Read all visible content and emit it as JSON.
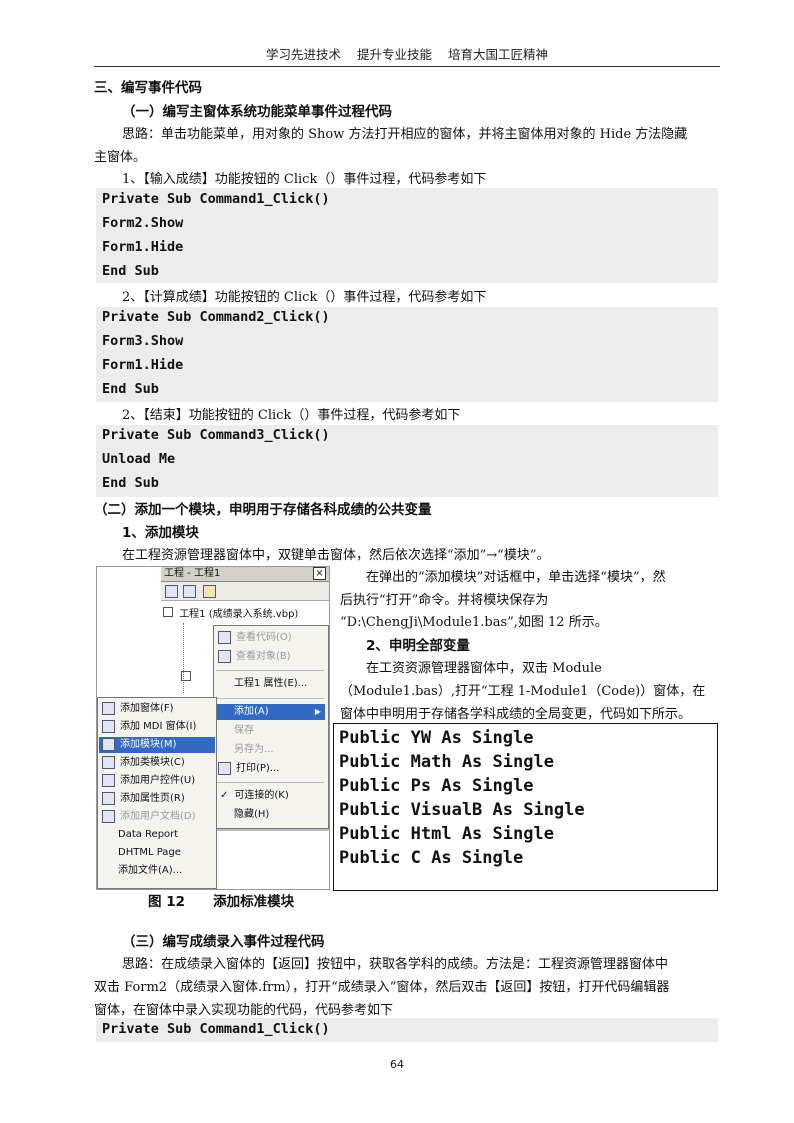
{
  "header": {
    "text": "学习先进技术    提升专业技能    培育大国工匠精神"
  },
  "section3": {
    "title": "三、编写事件代码"
  },
  "sub1": {
    "title": "（一）编写主窗体系统功能菜单事件过程代码"
  },
  "idea1": {
    "line1": "思路：单击功能菜单，用对象的 Show 方法打开相应的窗体，并将主窗体用对象的 Hide 方法隐藏",
    "line2": "主窗体。"
  },
  "step1": {
    "text": "1、【输入成绩】功能按钮的 Click（）事件过程，代码参考如下"
  },
  "code1": [
    "Private Sub Command1_Click()",
    " Form2.Show",
    " Form1.Hide",
    "End Sub"
  ],
  "step2": {
    "text": "2、【计算成绩】功能按钮的 Click（）事件过程，代码参考如下"
  },
  "code2": [
    "Private Sub Command2_Click()",
    " Form3.Show",
    " Form1.Hide",
    "End Sub"
  ],
  "step3": {
    "text": "2、【结束】功能按钮的 Click（）事件过程，代码参考如下"
  },
  "code3": [
    "Private Sub Command3_Click()",
    " Unload Me",
    "End Sub"
  ],
  "sub2": {
    "title": "（二）添加一个模块，申明用于存储各科成绩的公共变量"
  },
  "add_module": {
    "title": "1、添加模块",
    "text": "在工程资源管理器窗体中，双键单击窗体，然后依次选择“添加”→“模块”。"
  },
  "right_col": {
    "p1": "在弹出的“添加模块”对话框中，单击选择“模块”，然",
    "p2": "后执行“打开”命令。并将模块保存为",
    "p3": "“D:\\ChengJi\\Module1.bas”,如图 12 所示。",
    "h2": "2、申明全部变量",
    "p4": "在工资资源管理器窗体中，双击 Module",
    "p5": "（Module1.bas）,打开“工程 1-Module1（Code)）窗体，在",
    "p6": "窗体中申明用于存储各学科成绩的全局变更，代码如下所示。"
  },
  "vb_code": [
    "Public YW As Single",
    "Public Math As Single",
    "Public Ps As Single",
    "Public VisualB As Single",
    "Public Html As Single",
    "Public C As Single"
  ],
  "figure": {
    "caption": "图 12      添加标准模块",
    "window_title": "工程 - 工程1",
    "close": "×",
    "tree_root": "工程1 (成绩录入系统.vbp)",
    "context_menu": [
      "查看代码(O)",
      "查看对象(B)",
      "工程1 属性(E)...",
      "添加(A)",
      "保存",
      "另存为...",
      "打印(P)...",
      "可连接的(K)",
      "隐藏(H)"
    ],
    "submenu": [
      "添加窗体(F)",
      "添加 MDI 窗体(I)",
      "添加模块(M)",
      "添加类模块(C)",
      "添加用户控件(U)",
      "添加属性页(R)",
      "添加用户文档(D)",
      "Data Report",
      "DHTML Page",
      "添加文件(A)..."
    ],
    "arrow": "▶",
    "check": "✓"
  },
  "sub3": {
    "title": "（三）编写成绩录入事件过程代码"
  },
  "idea3": {
    "line1": "思路：在成绩录入窗体的【返回】按钮中，获取各学科的成绩。方法是：工程资源管理器窗体中",
    "line2": "双击 Form2（成绩录入窗体.frm），打开“成绩录入”窗体，然后双击【返回】按钮，打开代码编辑器",
    "line3": "窗体，在窗体中录入实现功能的代码，代码参考如下"
  },
  "code4": [
    "Private Sub Command1_Click()"
  ],
  "page_number": "64"
}
